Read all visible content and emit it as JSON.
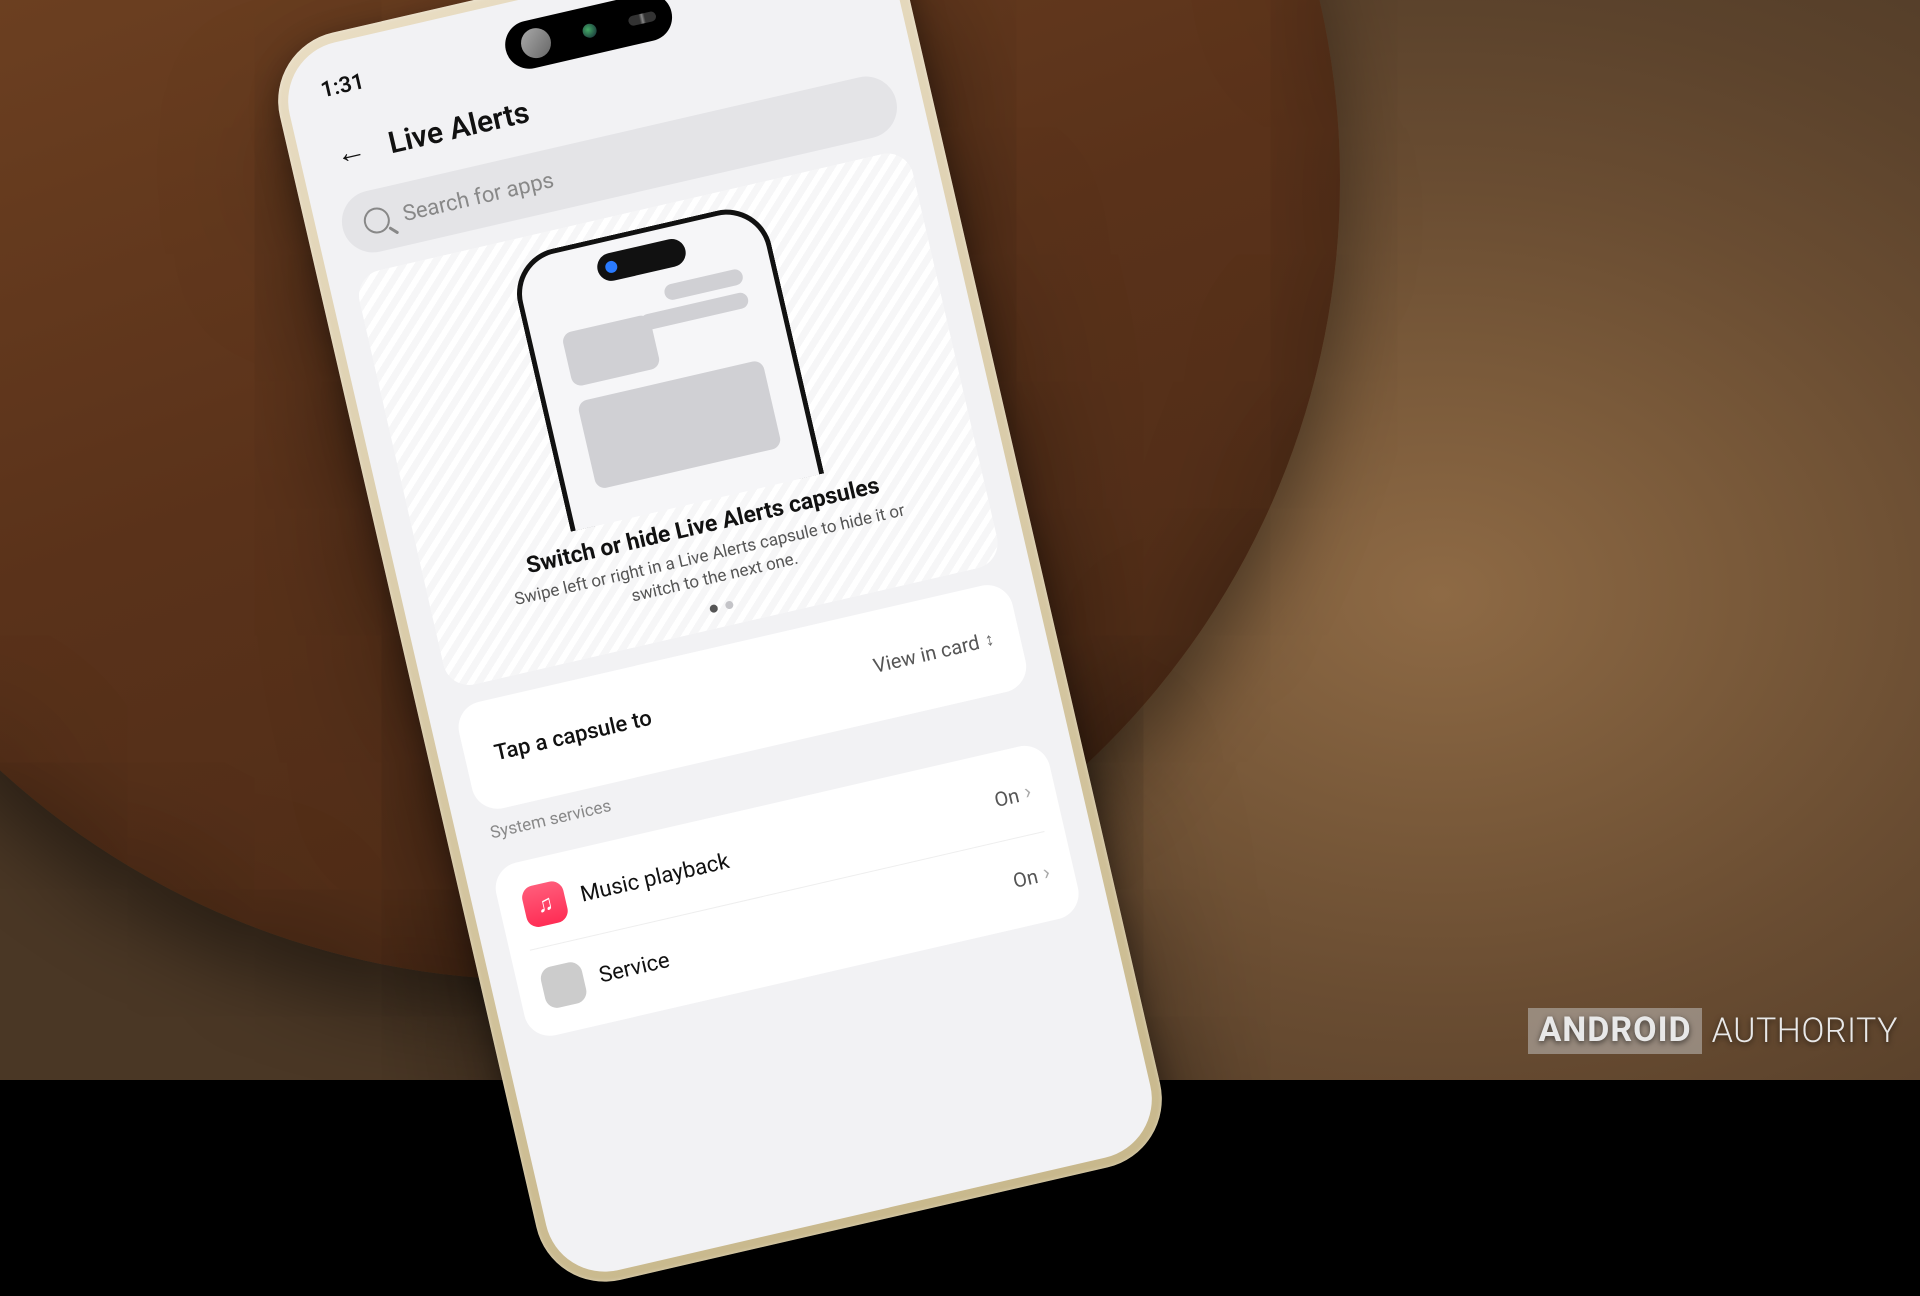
{
  "status": {
    "time": "1:31",
    "icons": {
      "bt": "bt",
      "nfc": "nfc",
      "battery": "battery"
    }
  },
  "header": {
    "title": "Live Alerts"
  },
  "search": {
    "placeholder": "Search for apps"
  },
  "hero": {
    "title": "Switch or hide Live Alerts capsules",
    "subtitle": "Swipe left or right in a Live Alerts capsule to hide it or switch to the next one."
  },
  "tap_row": {
    "label": "Tap a capsule to",
    "value": "View in card"
  },
  "sections": [
    {
      "label": "System services",
      "items": [
        {
          "icon": "music",
          "name": "Music playback",
          "state": "On"
        },
        {
          "icon": "service",
          "name": "Service",
          "state": "On"
        }
      ]
    }
  ],
  "watermark": {
    "brand_boxed": "ANDROID",
    "brand_rest": "AUTHORITY"
  }
}
